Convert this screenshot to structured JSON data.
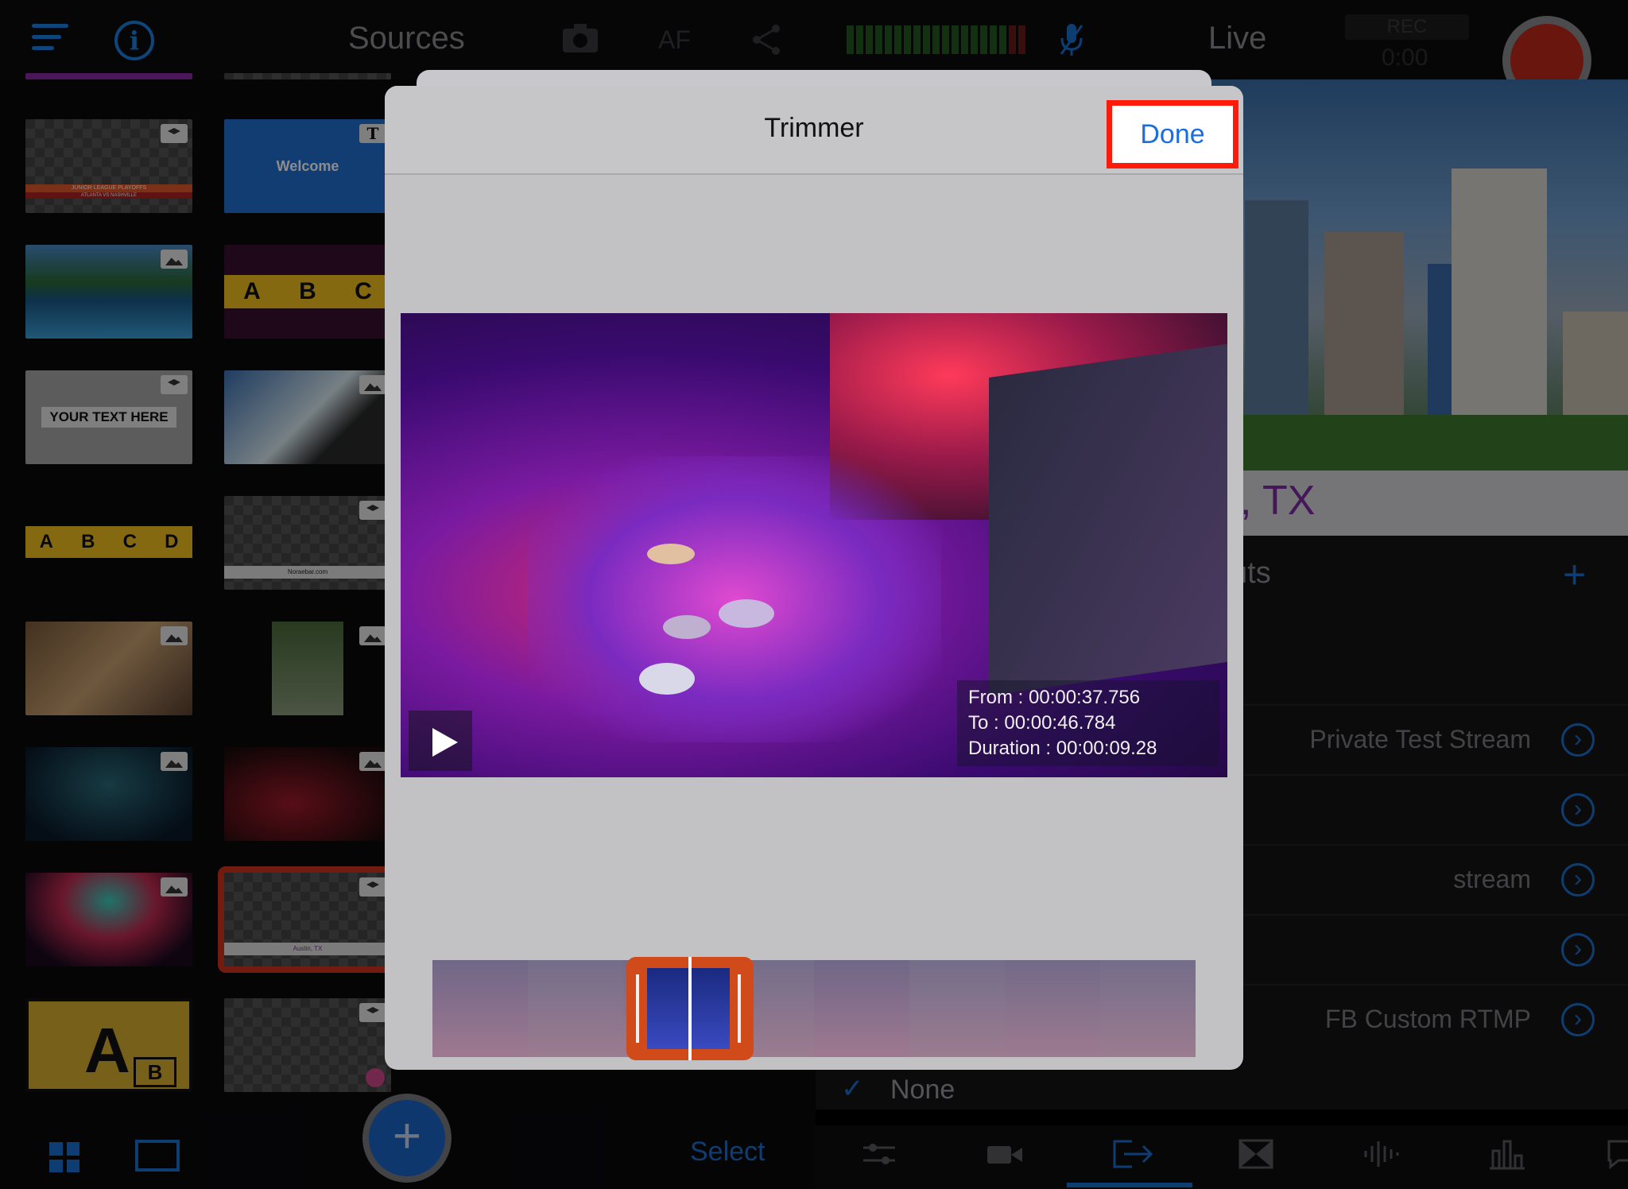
{
  "topbar": {
    "sources_title": "Sources",
    "af_label": "AF",
    "live_title": "Live",
    "rec_label": "REC",
    "rec_time": "0:00"
  },
  "thumbnails": {
    "junior_league_title": "JUNIOR LEAGUE PLAYOFFS",
    "junior_league_sub": "ATLANTA VS NASHVILLE",
    "welcome_text": "Welcome",
    "abc_letters": [
      "A",
      "B",
      "C"
    ],
    "your_text": "YOUR TEXT HERE",
    "abcd_letters": [
      "A",
      "B",
      "C",
      "D"
    ],
    "norebar_text": "Noraebar.com",
    "austin_text": "Austin, TX",
    "big_a": "A",
    "small_b": "B",
    "badge_t": "T"
  },
  "bottom_left": {
    "plus_label": "+",
    "select_label": "Select"
  },
  "live_panel": {
    "caption_fragment": ", TX",
    "outputs_fragment": "uts",
    "outputs_add": "+",
    "outputs": [
      {
        "label": "Private Test Stream"
      },
      {
        "label": ""
      },
      {
        "label": "stream"
      },
      {
        "label": ""
      },
      {
        "label": "FB Custom RTMP"
      }
    ],
    "chevron_glyph": "›",
    "none_check": "✓",
    "none_label": "None"
  },
  "trimmer": {
    "title": "Trimmer",
    "done_label": "Done",
    "from": "From : 00:00:37.756",
    "to": "To : 00:00:46.784",
    "duration": "Duration : 00:00:09.28"
  },
  "colors": {
    "accent_blue": "#1a6fd0",
    "record_red": "#c0281a",
    "highlight_red": "#ff1a0a",
    "trim_orange": "#d04a1a"
  }
}
